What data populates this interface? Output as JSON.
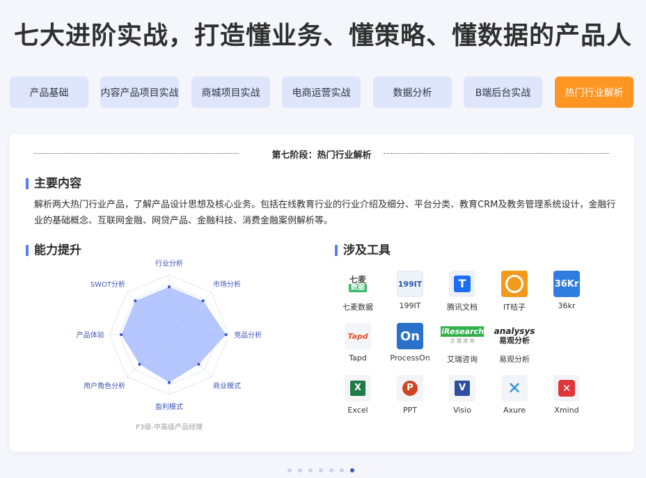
{
  "title": "七大进阶实战，打造懂业务、懂策略、懂数据的产品人",
  "tabs": [
    {
      "label": "产品基础"
    },
    {
      "label": "内容产品项目实战"
    },
    {
      "label": "商城项目实战"
    },
    {
      "label": "电商运营实战"
    },
    {
      "label": "数据分析"
    },
    {
      "label": "B端后台实战"
    },
    {
      "label": "热门行业解析"
    }
  ],
  "active_tab": 6,
  "accent_color": "#ff9523",
  "card": {
    "stage_title": "第七阶段：热门行业解析",
    "main_content_heading": "主要内容",
    "main_content_text": "解析两大热门行业产品，了解产品设计思想及核心业务。包括在线教育行业的行业介绍及细分、平台分类、教育CRM及教务管理系统设计，金融行业的基础概念、互联网金融、网贷产品、金融科技、消费金融案例解析等。",
    "ability_heading": "能力提升",
    "tools_heading": "涉及工具",
    "radar": {
      "axes": [
        "行业分析",
        "市场分析",
        "竞品分析",
        "商业模式",
        "盈利模式",
        "用户角色分析",
        "产品体验",
        "SWOT分析"
      ],
      "levels": [
        0.8,
        0.8,
        0.95,
        0.7,
        0.8,
        0.7,
        0.8,
        0.8
      ],
      "caption": "P3级-中高级产品经理",
      "fill_color": "#9db4ff",
      "point_color": "#3350c8"
    },
    "tools": [
      {
        "name": "七麦数据",
        "icon": "qimai-icon"
      },
      {
        "name": "199IT",
        "icon": "199it-icon"
      },
      {
        "name": "腾讯文档",
        "icon": "tencent-docs-icon"
      },
      {
        "name": "IT桔子",
        "icon": "itjuzi-icon"
      },
      {
        "name": "36kr",
        "icon": "36kr-icon"
      },
      {
        "name": "Tapd",
        "icon": "tapd-icon"
      },
      {
        "name": "ProcessOn",
        "icon": "processon-icon"
      },
      {
        "name": "艾瑞咨询",
        "icon": "iresearch-icon"
      },
      {
        "name": "易观分析",
        "icon": "analysys-icon"
      },
      {
        "name": "Excel",
        "icon": "excel-icon"
      },
      {
        "name": "PPT",
        "icon": "ppt-icon"
      },
      {
        "name": "Visio",
        "icon": "visio-icon"
      },
      {
        "name": "Axure",
        "icon": "axure-icon"
      },
      {
        "name": "Xmind",
        "icon": "xmind-icon"
      }
    ]
  },
  "pagination": {
    "count": 7,
    "active": 6
  }
}
